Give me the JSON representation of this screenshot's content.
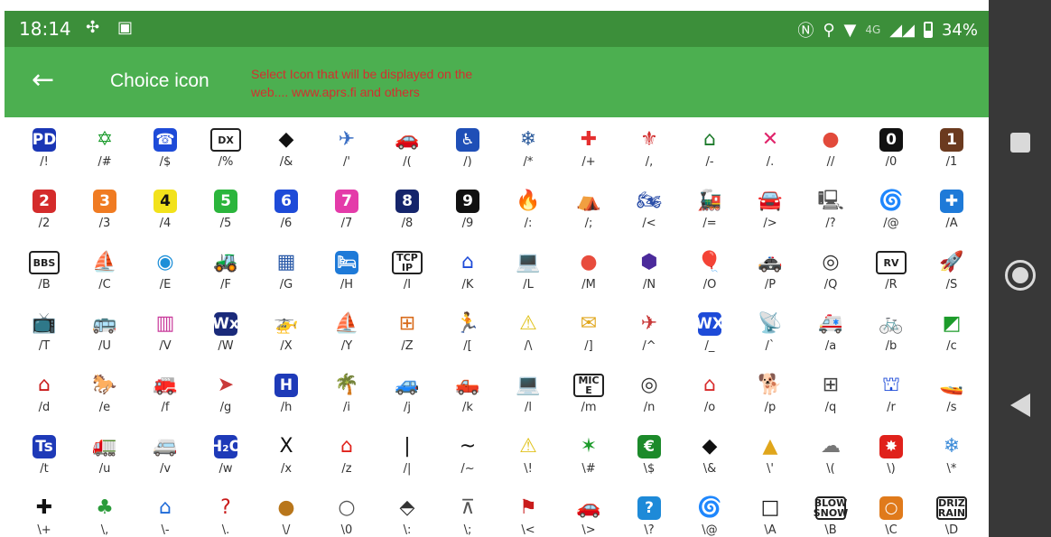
{
  "status_bar": {
    "time": "18:14",
    "left_icons": [
      "fan-icon",
      "image-icon"
    ],
    "network": "4G",
    "battery": "34%"
  },
  "app_bar": {
    "back_icon": "arrow-left-icon",
    "title": "Choice icon",
    "subtitle": "Select Icon that will be displayed on the web.... www.aprs.fi and others"
  },
  "icons": [
    {
      "code": "/!",
      "g": "PD",
      "kind": "box",
      "color": "#1a36b5"
    },
    {
      "code": "/#",
      "g": "✡",
      "color": "#1a9b2b"
    },
    {
      "code": "/$",
      "g": "☎",
      "kind": "box",
      "color": "#1e4bd8"
    },
    {
      "code": "/%",
      "g": "DX",
      "kind": "txt"
    },
    {
      "code": "/&",
      "g": "◆",
      "color": "#111"
    },
    {
      "code": "/'",
      "g": "✈",
      "color": "#3b6fc4"
    },
    {
      "code": "/(",
      "g": "🚗",
      "color": "#c9302c"
    },
    {
      "code": "/)",
      "g": "♿",
      "kind": "box",
      "color": "#1f4fb7"
    },
    {
      "code": "/*",
      "g": "❄",
      "color": "#2b5a9b"
    },
    {
      "code": "/+",
      "g": "✚",
      "color": "#e52f2f"
    },
    {
      "code": "/,",
      "g": "⚜",
      "color": "#d12d2d"
    },
    {
      "code": "/-",
      "g": "⌂",
      "color": "#1c7a2a"
    },
    {
      "code": "/.",
      "g": "✕",
      "color": "#e0256b"
    },
    {
      "code": "//",
      "g": "●",
      "color": "#e24a3b"
    },
    {
      "code": "/0",
      "g": "0",
      "kind": "box",
      "color": "#111"
    },
    {
      "code": "/1",
      "g": "1",
      "kind": "box",
      "color": "#6b3a1f"
    },
    {
      "code": "/2",
      "g": "2",
      "kind": "box",
      "color": "#d42b2b"
    },
    {
      "code": "/3",
      "g": "3",
      "kind": "box",
      "color": "#f07b22"
    },
    {
      "code": "/4",
      "g": "4",
      "kind": "box",
      "color": "#f2e21b"
    },
    {
      "code": "/5",
      "g": "5",
      "kind": "box",
      "color": "#2bb53c"
    },
    {
      "code": "/6",
      "g": "6",
      "kind": "box",
      "color": "#1e4bd8"
    },
    {
      "code": "/7",
      "g": "7",
      "kind": "box",
      "color": "#e43ba9"
    },
    {
      "code": "/8",
      "g": "8",
      "kind": "box",
      "color": "#15256b"
    },
    {
      "code": "/9",
      "g": "9",
      "kind": "box",
      "color": "#111"
    },
    {
      "code": "/:",
      "g": "🔥",
      "color": "#ef6b1a"
    },
    {
      "code": "/;",
      "g": "⛺",
      "color": "#2a9b3a"
    },
    {
      "code": "/<",
      "g": "🏍",
      "color": "#2b4ea8"
    },
    {
      "code": "/=",
      "g": "🚂",
      "color": "#c93a3a"
    },
    {
      "code": "/>",
      "g": "🚘",
      "color": "#c93a3a"
    },
    {
      "code": "/?",
      "g": "🖳",
      "color": "#555"
    },
    {
      "code": "/@",
      "g": "🌀",
      "color": "#e0352b"
    },
    {
      "code": "/A",
      "g": "✚",
      "kind": "box",
      "color": "#1e7ad8"
    },
    {
      "code": "/B",
      "g": "BBS",
      "kind": "txt"
    },
    {
      "code": "/C",
      "g": "⛵",
      "color": "#c9302c"
    },
    {
      "code": "/E",
      "g": "◉",
      "color": "#1d8fd8"
    },
    {
      "code": "/F",
      "g": "🚜",
      "color": "#2a7a2a"
    },
    {
      "code": "/G",
      "g": "▦",
      "color": "#2a5aa8"
    },
    {
      "code": "/H",
      "g": "🛏",
      "kind": "box",
      "color": "#1e7ad8"
    },
    {
      "code": "/I",
      "g": "TCP IP",
      "kind": "txt"
    },
    {
      "code": "/K",
      "g": "⌂",
      "color": "#1e4bd8"
    },
    {
      "code": "/L",
      "g": "💻",
      "color": "#3a8ad8"
    },
    {
      "code": "/M",
      "g": "●",
      "color": "#e84c3d"
    },
    {
      "code": "/N",
      "g": "⬢",
      "color": "#4b2a9b"
    },
    {
      "code": "/O",
      "g": "🎈",
      "color": "#e0452b"
    },
    {
      "code": "/P",
      "g": "🚓",
      "color": "#1e3ab8"
    },
    {
      "code": "/Q",
      "g": "◎",
      "color": "#333"
    },
    {
      "code": "/R",
      "g": "RV",
      "kind": "txt"
    },
    {
      "code": "/S",
      "g": "🚀",
      "color": "#666"
    },
    {
      "code": "/T",
      "g": "📺",
      "color": "#555"
    },
    {
      "code": "/U",
      "g": "🚌",
      "color": "#e0a61b"
    },
    {
      "code": "/V",
      "g": "▥",
      "color": "#c93a9b"
    },
    {
      "code": "/W",
      "g": "Wx",
      "kind": "box",
      "color": "#1a2a7a"
    },
    {
      "code": "/X",
      "g": "🚁",
      "color": "#e0a61b"
    },
    {
      "code": "/Y",
      "g": "⛵",
      "color": "#2a9b3a"
    },
    {
      "code": "/Z",
      "g": "⊞",
      "color": "#d86b1b"
    },
    {
      "code": "/[",
      "g": "🏃",
      "color": "#c92aa8"
    },
    {
      "code": "/\\",
      "g": "⚠",
      "color": "#e0c21b"
    },
    {
      "code": "/]",
      "g": "✉",
      "color": "#e0a61b"
    },
    {
      "code": "/^",
      "g": "✈",
      "color": "#c93a3a"
    },
    {
      "code": "/_",
      "g": "WX",
      "kind": "box",
      "color": "#1e4bd8"
    },
    {
      "code": "/`",
      "g": "📡",
      "color": "#1e4bd8"
    },
    {
      "code": "/a",
      "g": "🚑",
      "color": "#e0c21b"
    },
    {
      "code": "/b",
      "g": "🚲",
      "color": "#555"
    },
    {
      "code": "/c",
      "g": "◩",
      "color": "#1c9b2a"
    },
    {
      "code": "/d",
      "g": "⌂",
      "color": "#c91b1b"
    },
    {
      "code": "/e",
      "g": "🐎",
      "color": "#8a4a1b"
    },
    {
      "code": "/f",
      "g": "🚒",
      "color": "#d82b2b"
    },
    {
      "code": "/g",
      "g": "➤",
      "color": "#c93a3a"
    },
    {
      "code": "/h",
      "g": "H",
      "kind": "box",
      "color": "#1e3ab8"
    },
    {
      "code": "/i",
      "g": "🌴",
      "color": "#2a9b3a"
    },
    {
      "code": "/j",
      "g": "🚙",
      "color": "#2a7a2a"
    },
    {
      "code": "/k",
      "g": "🛻",
      "color": "#c93a3a"
    },
    {
      "code": "/l",
      "g": "💻",
      "color": "#3a6ad8"
    },
    {
      "code": "/m",
      "g": "MIC E",
      "kind": "txt"
    },
    {
      "code": "/n",
      "g": "◎",
      "color": "#333"
    },
    {
      "code": "/o",
      "g": "⌂",
      "color": "#d82b2b"
    },
    {
      "code": "/p",
      "g": "🐕",
      "color": "#8a5a2b"
    },
    {
      "code": "/q",
      "g": "⊞",
      "color": "#444"
    },
    {
      "code": "/r",
      "g": "⛫",
      "color": "#1e4bd8"
    },
    {
      "code": "/s",
      "g": "🚤",
      "color": "#1e6ad8"
    },
    {
      "code": "/t",
      "g": "Ts",
      "kind": "box",
      "color": "#1e3ab8"
    },
    {
      "code": "/u",
      "g": "🚛",
      "color": "#1e3ab8"
    },
    {
      "code": "/v",
      "g": "🚐",
      "color": "#3a6ad8"
    },
    {
      "code": "/w",
      "g": "H₂O",
      "kind": "box",
      "color": "#1e3ab8"
    },
    {
      "code": "/x",
      "g": "X",
      "color": "#111"
    },
    {
      "code": "/z",
      "g": "⌂",
      "color": "#e0211b"
    },
    {
      "code": "/|",
      "g": "|",
      "color": "#111"
    },
    {
      "code": "/~",
      "g": "~",
      "color": "#111"
    },
    {
      "code": "\\!",
      "g": "⚠",
      "color": "#e0c21b"
    },
    {
      "code": "\\#",
      "g": "✶",
      "color": "#1c9b2a"
    },
    {
      "code": "\\$",
      "g": "€",
      "kind": "box",
      "color": "#1c8a2a"
    },
    {
      "code": "\\&",
      "g": "◆",
      "color": "#111"
    },
    {
      "code": "\\'",
      "g": "▲",
      "color": "#e0a61b"
    },
    {
      "code": "\\(",
      "g": "☁",
      "color": "#777"
    },
    {
      "code": "\\)",
      "g": "✸",
      "kind": "box",
      "color": "#e0211b"
    },
    {
      "code": "\\*",
      "g": "❄",
      "color": "#3a8ad8"
    },
    {
      "code": "\\+",
      "g": "✚",
      "color": "#111"
    },
    {
      "code": "\\,",
      "g": "♣",
      "color": "#2a9b3a"
    },
    {
      "code": "\\-",
      "g": "⌂",
      "color": "#1e6ad8"
    },
    {
      "code": "\\.",
      "g": "?",
      "color": "#c91b1b"
    },
    {
      "code": "\\/",
      "g": "●",
      "color": "#b8761b"
    },
    {
      "code": "\\0",
      "g": "○",
      "color": "#555"
    },
    {
      "code": "\\:",
      "g": "⬘",
      "color": "#333"
    },
    {
      "code": "\\;",
      "g": "⊼",
      "color": "#555"
    },
    {
      "code": "\\<",
      "g": "⚑",
      "color": "#c91b1b"
    },
    {
      "code": "\\>",
      "g": "🚗",
      "color": "#d82b2b"
    },
    {
      "code": "\\?",
      "g": "?",
      "kind": "box",
      "color": "#1e8ad8"
    },
    {
      "code": "\\@",
      "g": "🌀",
      "color": "#e0352b"
    },
    {
      "code": "\\A",
      "g": "□",
      "color": "#111"
    },
    {
      "code": "\\B",
      "g": "BLOW SNOW",
      "kind": "txt"
    },
    {
      "code": "\\C",
      "g": "○",
      "kind": "box",
      "color": "#e07a1b"
    },
    {
      "code": "\\D",
      "g": "DRIZ RAIN",
      "kind": "txt"
    }
  ],
  "nav": {
    "recent_icon": "square-icon",
    "home_icon": "circle-icon",
    "back_icon": "triangle-back-icon"
  }
}
